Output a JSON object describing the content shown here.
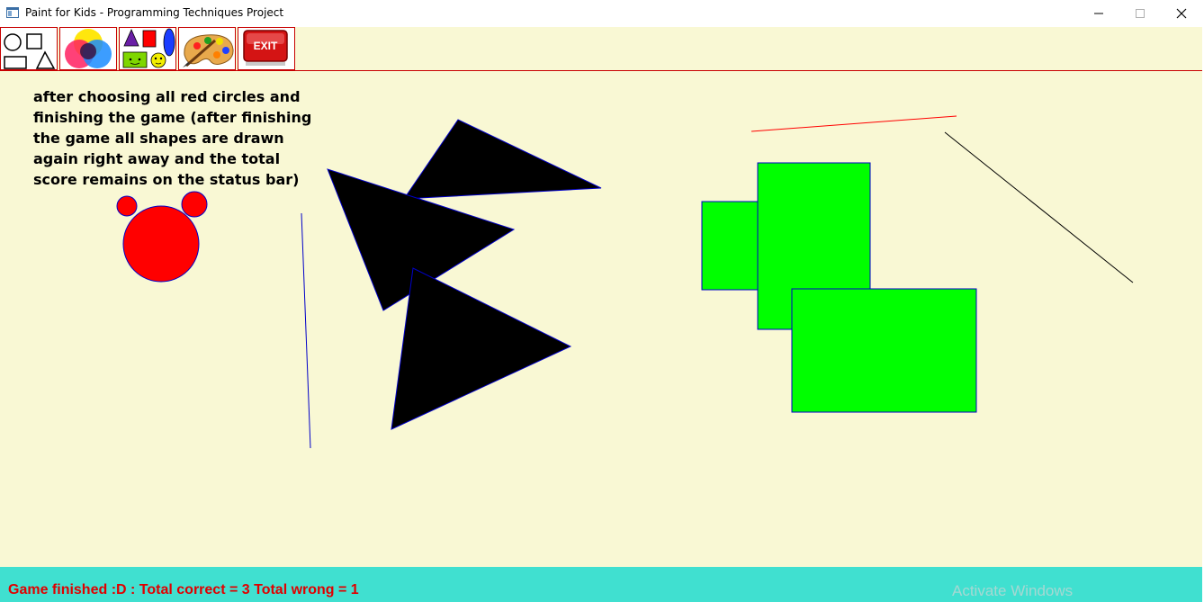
{
  "window": {
    "title": "Paint for Kids - Programming Techniques Project",
    "controls": [
      "minimize",
      "maximize",
      "close"
    ]
  },
  "toolbar": {
    "items": [
      {
        "name": "draw-shapes-tool",
        "icon": "shapes-icon"
      },
      {
        "name": "color-tool",
        "icon": "color-circles-icon"
      },
      {
        "name": "play-mode-tool",
        "icon": "kids-shapes-icon"
      },
      {
        "name": "paint-palette-tool",
        "icon": "palette-icon"
      },
      {
        "name": "exit-tool",
        "icon": "exit-icon",
        "label": "EXIT"
      }
    ]
  },
  "canvas": {
    "note": "after choosing all red circles and finishing the game (after finishing the game all shapes are drawn again right away and the total score remains on the status bar)",
    "background": "#f9f8d4",
    "colors": {
      "circle_fill": "#ff0000",
      "triangle_fill": "#000000",
      "rectangle_fill": "#00ff00",
      "outline": "#0000c8",
      "line_red": "#ff0000",
      "line_blue": "#0000c8",
      "line_black": "#000000"
    }
  },
  "statusbar": {
    "text": "Game finished :D : Total correct = 3 Total wrong = 1",
    "watermark": "Activate Windows",
    "background": "#40e0d0",
    "text_color": "#e00000"
  }
}
